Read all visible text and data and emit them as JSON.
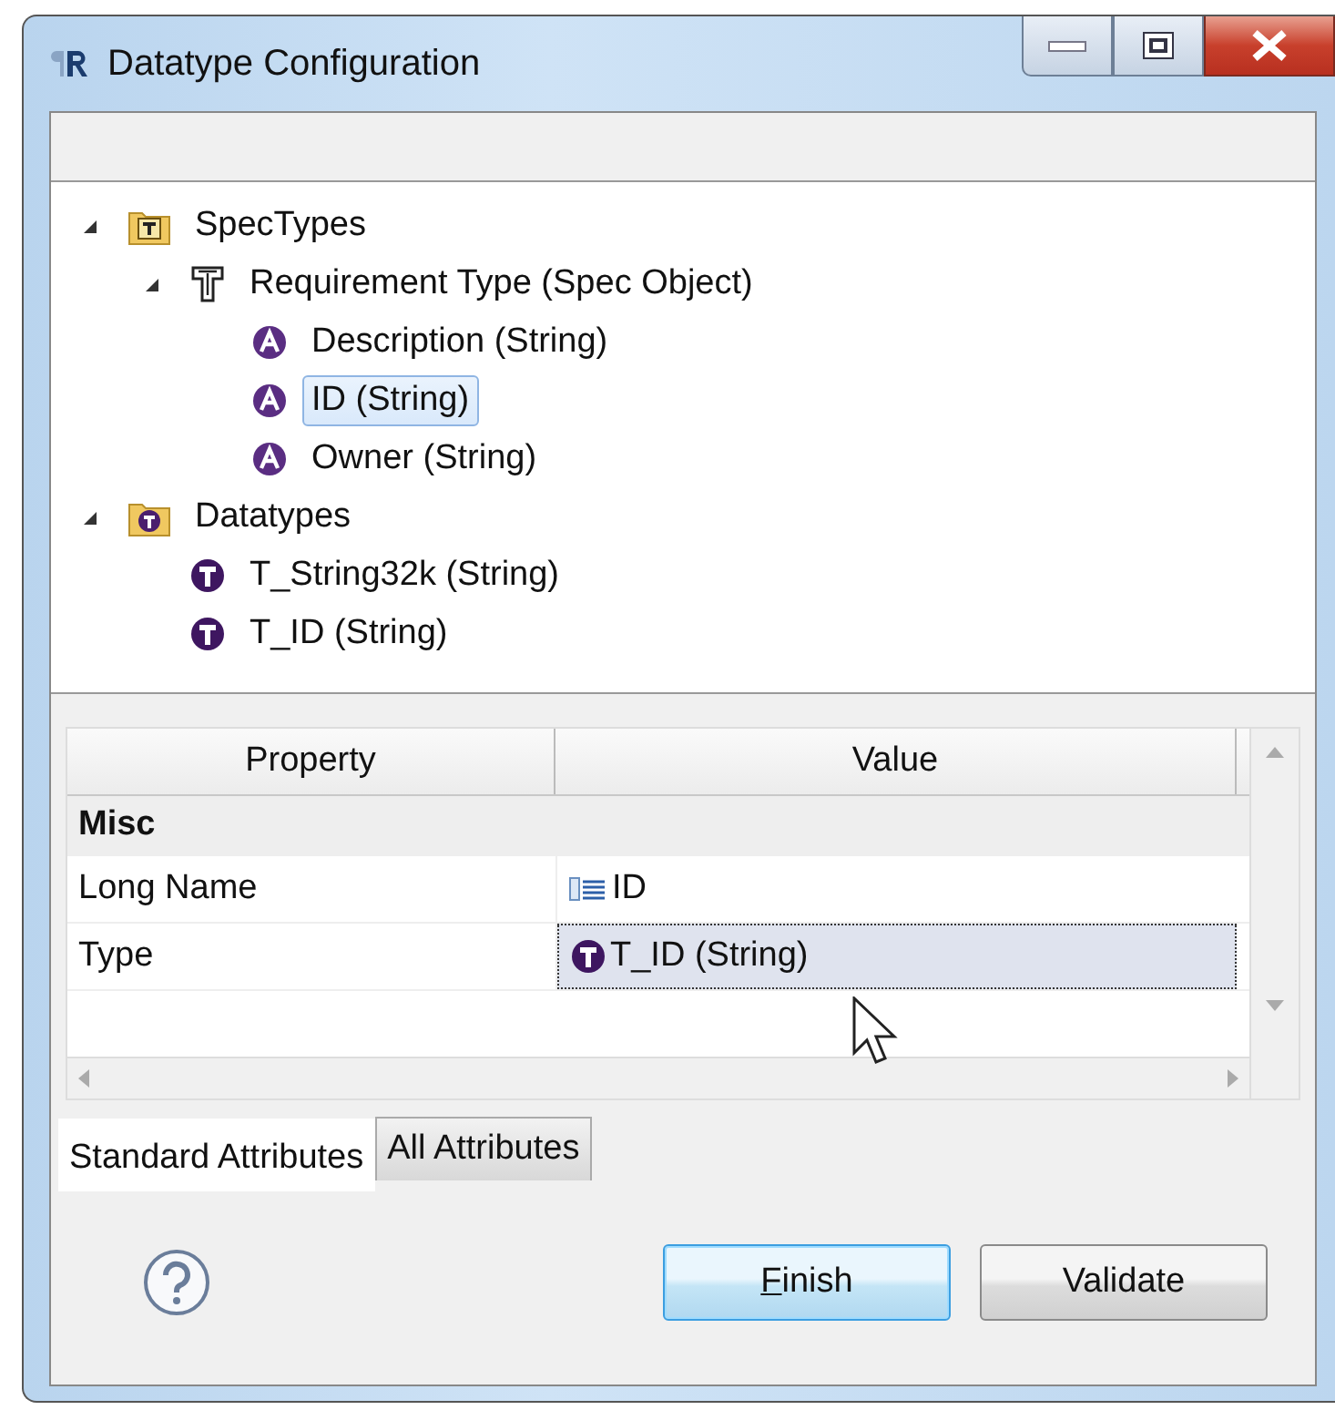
{
  "window": {
    "title": "Datatype Configuration"
  },
  "tree": [
    {
      "label": "SpecTypes",
      "kind": "spec-folder",
      "expanded": true,
      "selected": false,
      "children": [
        {
          "label": "Requirement Type (Spec Object)",
          "kind": "spec-type",
          "expanded": true,
          "selected": false,
          "children": [
            {
              "label": "Description (String)",
              "kind": "attribute",
              "selected": false
            },
            {
              "label": "ID (String)",
              "kind": "attribute",
              "selected": true
            },
            {
              "label": "Owner (String)",
              "kind": "attribute",
              "selected": false
            }
          ]
        }
      ]
    },
    {
      "label": "Datatypes",
      "kind": "datatype-folder",
      "expanded": true,
      "selected": false,
      "children": [
        {
          "label": "T_String32k (String)",
          "kind": "datatype",
          "selected": false
        },
        {
          "label": "T_ID (String)",
          "kind": "datatype",
          "selected": false
        }
      ]
    }
  ],
  "properties": {
    "columns": [
      "Property",
      "Value"
    ],
    "groups": [
      {
        "name": "Misc",
        "rows": [
          {
            "property": "Long Name",
            "value": "ID",
            "kind": "text",
            "selected": false
          },
          {
            "property": "Type",
            "value": "T_ID (String)",
            "kind": "datatype",
            "selected": true
          }
        ]
      }
    ]
  },
  "tabs": [
    {
      "label": "Standard Attributes",
      "selected": true
    },
    {
      "label": "All Attributes",
      "selected": false
    }
  ],
  "buttons": [
    {
      "label": "Finish",
      "default": true,
      "mnemonic_underlined": true
    },
    {
      "label": "Validate",
      "default": false
    }
  ]
}
